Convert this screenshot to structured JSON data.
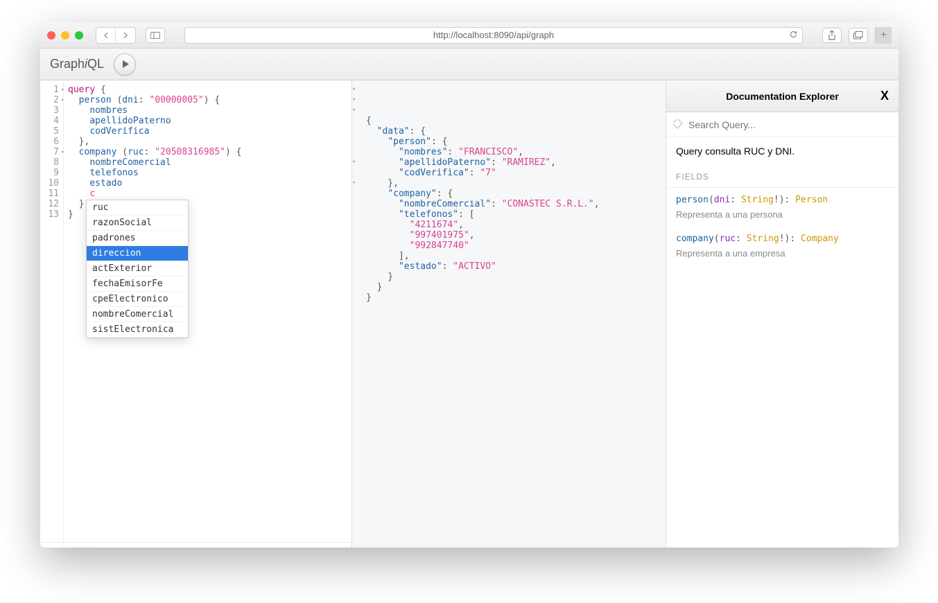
{
  "browser": {
    "url": "http://localhost:8090/api/graph"
  },
  "toolbar": {
    "logo_prefix": "Graph",
    "logo_i": "i",
    "logo_suffix": "QL"
  },
  "editor": {
    "line_numbers": [
      "1",
      "2",
      "3",
      "4",
      "5",
      "6",
      "7",
      "8",
      "9",
      "10",
      "11",
      "12",
      "13"
    ],
    "lines": [
      {
        "t": [
          {
            "c": "kw",
            "v": "query"
          },
          {
            "c": "punc",
            "v": " {"
          }
        ]
      },
      {
        "t": [
          {
            "c": "punc",
            "v": "  "
          },
          {
            "c": "fn",
            "v": "person"
          },
          {
            "c": "punc",
            "v": " ("
          },
          {
            "c": "attr",
            "v": "dni"
          },
          {
            "c": "punc",
            "v": ": "
          },
          {
            "c": "str",
            "v": "\"00000005\""
          },
          {
            "c": "punc",
            "v": ") {"
          }
        ]
      },
      {
        "t": [
          {
            "c": "punc",
            "v": "    "
          },
          {
            "c": "attr",
            "v": "nombres"
          }
        ]
      },
      {
        "t": [
          {
            "c": "punc",
            "v": "    "
          },
          {
            "c": "attr",
            "v": "apellidoPaterno"
          }
        ]
      },
      {
        "t": [
          {
            "c": "punc",
            "v": "    "
          },
          {
            "c": "attr",
            "v": "codVerifica"
          }
        ]
      },
      {
        "t": [
          {
            "c": "punc",
            "v": "  },"
          }
        ]
      },
      {
        "t": [
          {
            "c": "punc",
            "v": "  "
          },
          {
            "c": "fn",
            "v": "company"
          },
          {
            "c": "punc",
            "v": " ("
          },
          {
            "c": "attr",
            "v": "ruc"
          },
          {
            "c": "punc",
            "v": ": "
          },
          {
            "c": "str",
            "v": "\"20508316985\""
          },
          {
            "c": "punc",
            "v": ") {"
          }
        ]
      },
      {
        "t": [
          {
            "c": "punc",
            "v": "    "
          },
          {
            "c": "attr",
            "v": "nombreComercial"
          }
        ]
      },
      {
        "t": [
          {
            "c": "punc",
            "v": "    "
          },
          {
            "c": "attr",
            "v": "telefonos"
          }
        ]
      },
      {
        "t": [
          {
            "c": "punc",
            "v": "    "
          },
          {
            "c": "attr",
            "v": "estado"
          }
        ]
      },
      {
        "t": [
          {
            "c": "punc",
            "v": "    "
          },
          {
            "c": "partial",
            "v": "c"
          }
        ]
      },
      {
        "t": [
          {
            "c": "punc",
            "v": "  }"
          }
        ]
      },
      {
        "t": [
          {
            "c": "punc",
            "v": "}"
          }
        ]
      }
    ],
    "fold_lines": [
      1,
      2,
      7
    ]
  },
  "autocomplete": {
    "items": [
      "ruc",
      "razonSocial",
      "padrones",
      "direccion",
      "actExterior",
      "fechaEmisorFe",
      "cpeElectronico",
      "nombreComercial",
      "sistElectronica"
    ],
    "selected_index": 3
  },
  "result": {
    "lines": [
      {
        "t": [
          {
            "c": "rpunc",
            "v": "{"
          }
        ]
      },
      {
        "t": [
          {
            "c": "rpunc",
            "v": "  "
          },
          {
            "c": "rkey",
            "v": "\"data\""
          },
          {
            "c": "rpunc",
            "v": ": {"
          }
        ]
      },
      {
        "t": [
          {
            "c": "rpunc",
            "v": "    "
          },
          {
            "c": "rkey",
            "v": "\"person\""
          },
          {
            "c": "rpunc",
            "v": ": {"
          }
        ]
      },
      {
        "t": [
          {
            "c": "rpunc",
            "v": "      "
          },
          {
            "c": "rkey",
            "v": "\"nombres\""
          },
          {
            "c": "rpunc",
            "v": ": "
          },
          {
            "c": "rstr",
            "v": "\"FRANCISCO\""
          },
          {
            "c": "rpunc",
            "v": ","
          }
        ]
      },
      {
        "t": [
          {
            "c": "rpunc",
            "v": "      "
          },
          {
            "c": "rkey",
            "v": "\"apellidoPaterno\""
          },
          {
            "c": "rpunc",
            "v": ": "
          },
          {
            "c": "rstr",
            "v": "\"RAMIREZ\""
          },
          {
            "c": "rpunc",
            "v": ","
          }
        ]
      },
      {
        "t": [
          {
            "c": "rpunc",
            "v": "      "
          },
          {
            "c": "rkey",
            "v": "\"codVerifica\""
          },
          {
            "c": "rpunc",
            "v": ": "
          },
          {
            "c": "rstr",
            "v": "\"7\""
          }
        ]
      },
      {
        "t": [
          {
            "c": "rpunc",
            "v": "    },"
          }
        ]
      },
      {
        "t": [
          {
            "c": "rpunc",
            "v": "    "
          },
          {
            "c": "rkey",
            "v": "\"company\""
          },
          {
            "c": "rpunc",
            "v": ": {"
          }
        ]
      },
      {
        "t": [
          {
            "c": "rpunc",
            "v": "      "
          },
          {
            "c": "rkey",
            "v": "\"nombreComercial\""
          },
          {
            "c": "rpunc",
            "v": ": "
          },
          {
            "c": "rstr",
            "v": "\"CONASTEC S.R.L.\""
          },
          {
            "c": "rpunc",
            "v": ","
          }
        ]
      },
      {
        "t": [
          {
            "c": "rpunc",
            "v": "      "
          },
          {
            "c": "rkey",
            "v": "\"telefonos\""
          },
          {
            "c": "rpunc",
            "v": ": ["
          }
        ]
      },
      {
        "t": [
          {
            "c": "rpunc",
            "v": "        "
          },
          {
            "c": "rstr",
            "v": "\"4211674\""
          },
          {
            "c": "rpunc",
            "v": ","
          }
        ]
      },
      {
        "t": [
          {
            "c": "rpunc",
            "v": "        "
          },
          {
            "c": "rstr",
            "v": "\"997401975\""
          },
          {
            "c": "rpunc",
            "v": ","
          }
        ]
      },
      {
        "t": [
          {
            "c": "rpunc",
            "v": "        "
          },
          {
            "c": "rstr",
            "v": "\"992847740\""
          }
        ]
      },
      {
        "t": [
          {
            "c": "rpunc",
            "v": "      ],"
          }
        ]
      },
      {
        "t": [
          {
            "c": "rpunc",
            "v": "      "
          },
          {
            "c": "rkey",
            "v": "\"estado\""
          },
          {
            "c": "rpunc",
            "v": ": "
          },
          {
            "c": "rstr",
            "v": "\"ACTIVO\""
          }
        ]
      },
      {
        "t": [
          {
            "c": "rpunc",
            "v": "    }"
          }
        ]
      },
      {
        "t": [
          {
            "c": "rpunc",
            "v": "  }"
          }
        ]
      },
      {
        "t": [
          {
            "c": "rpunc",
            "v": "}"
          }
        ]
      }
    ],
    "fold_lines": [
      1,
      2,
      3,
      8,
      10
    ]
  },
  "docs": {
    "title": "Documentation Explorer",
    "close": "X",
    "search_placeholder": "Search Query...",
    "description": "Query consulta RUC y DNI.",
    "fields_label": "FIELDS",
    "fields": [
      {
        "name": "person",
        "arg_name": "dni",
        "arg_type": "String",
        "return_type": "Person",
        "desc": "Representa a una persona"
      },
      {
        "name": "company",
        "arg_name": "ruc",
        "arg_type": "String",
        "return_type": "Company",
        "desc": "Representa a una empresa"
      }
    ]
  }
}
